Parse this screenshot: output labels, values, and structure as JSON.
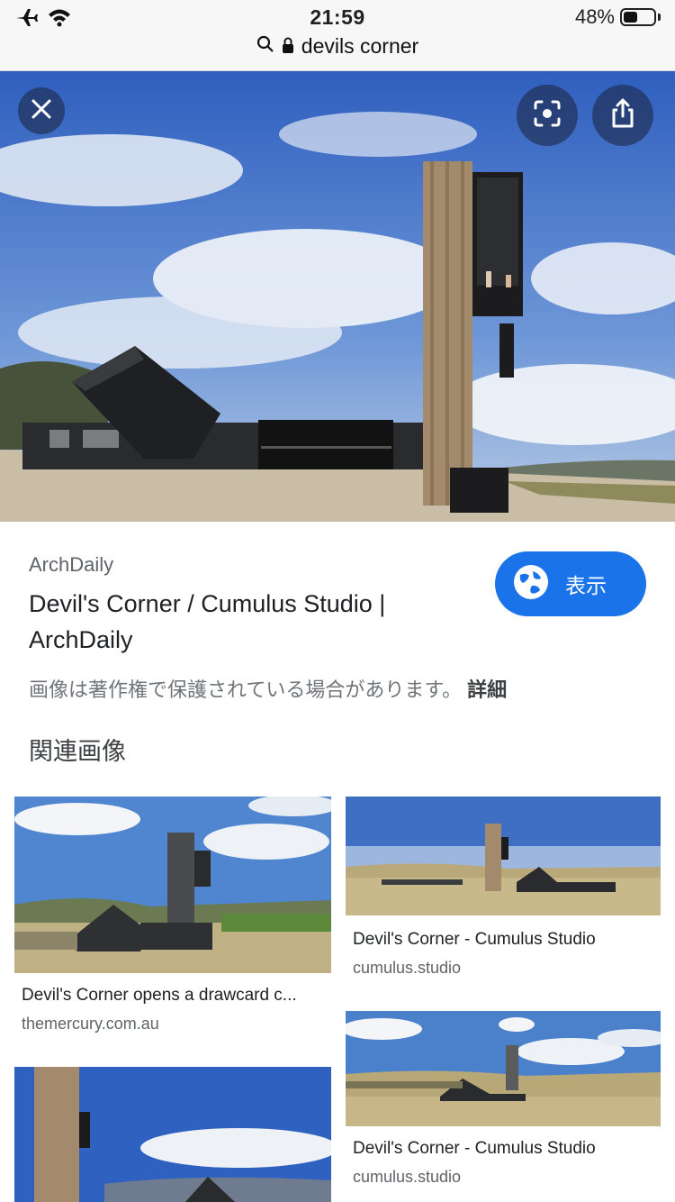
{
  "status_bar": {
    "time": "21:59",
    "battery_percent_text": "48%",
    "battery_level": 0.48,
    "icons": [
      "airplane-icon",
      "wifi-icon"
    ]
  },
  "url_bar": {
    "query": "devils corner"
  },
  "hero": {
    "close_icon": "close-icon",
    "lens_icon": "lens-icon",
    "share_icon": "share-icon"
  },
  "result": {
    "source": "ArchDaily",
    "title": "Devil's Corner / Cumulus Studio | ArchDaily",
    "visit_button_label": "表示",
    "copyright_notice": "画像は著作権で保護されている場合があります。",
    "details_link": "詳細"
  },
  "related": {
    "heading": "関連画像",
    "items": [
      {
        "title": "Devil's Corner opens a drawcard c...",
        "domain": "themercury.com.au"
      },
      {
        "title": "Devil's Corner - Cumulus Studio",
        "domain": "cumulus.studio"
      },
      {
        "title": "Devil's Corner - Cumulus Studio",
        "domain": "cumulus.studio"
      }
    ]
  },
  "colors": {
    "accent": "#1a73e8",
    "sky": "#3f6fcf",
    "ground": "#c9bda6",
    "building": "#2a2b2e",
    "timber": "#a48a6c"
  }
}
